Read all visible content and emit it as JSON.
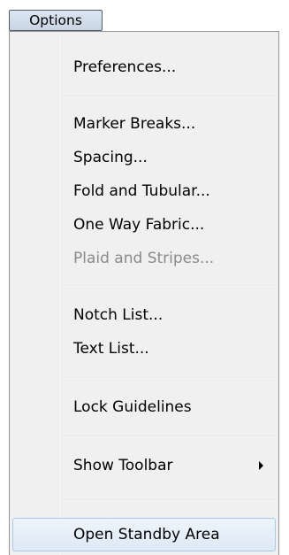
{
  "menubar": {
    "title": "Options"
  },
  "menu": {
    "items": [
      {
        "label": "Preferences..."
      },
      {
        "label": "Marker Breaks..."
      },
      {
        "label": "Spacing..."
      },
      {
        "label": "Fold and Tubular..."
      },
      {
        "label": "One Way Fabric..."
      },
      {
        "label": "Plaid and Stripes...",
        "disabled": true
      },
      {
        "label": "Notch List..."
      },
      {
        "label": "Text List..."
      },
      {
        "label": "Lock Guidelines"
      },
      {
        "label": "Show Toolbar",
        "has_submenu": true
      },
      {
        "label": "Open Standby Area",
        "highlighted": true
      }
    ]
  }
}
